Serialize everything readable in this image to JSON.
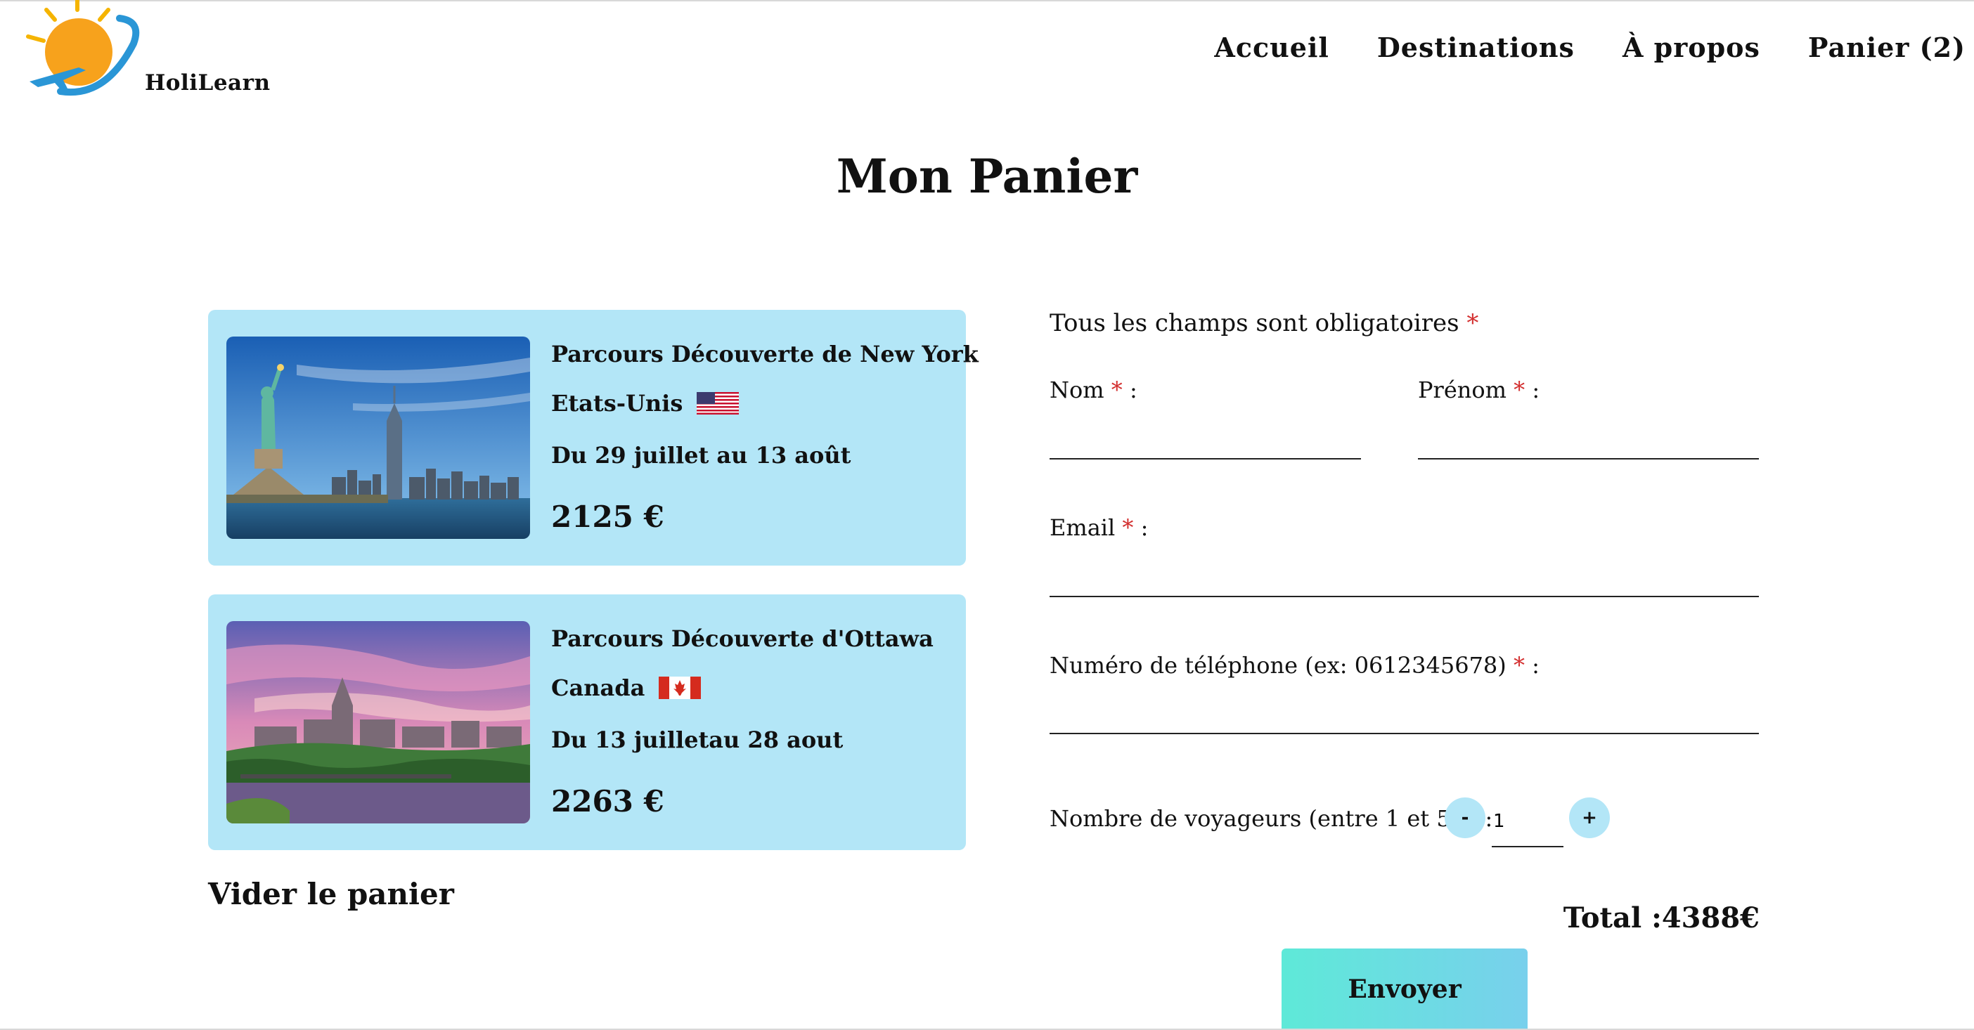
{
  "header": {
    "logo_text": "HoliLearn",
    "nav": [
      "Accueil",
      "Destinations",
      "À propos",
      "Panier (2)"
    ]
  },
  "page": {
    "title": "Mon Panier"
  },
  "cart": {
    "items": [
      {
        "title": "Parcours Découverte de New York",
        "country": "Etats-Unis",
        "flag": "us-flag-icon",
        "dates": "Du 29 juillet au 13 août",
        "price": "2125 €"
      },
      {
        "title": "Parcours Découverte d'Ottawa",
        "country": "Canada",
        "flag": "canada-flag-icon",
        "dates": "Du 13 juilletau 28 aout",
        "price": "2263 €"
      }
    ],
    "clear_label": "Vider le panier"
  },
  "form": {
    "note": "Tous les champs sont obligatoires",
    "required_mark": "*",
    "nom_label": "Nom",
    "prenom_label": "Prénom",
    "email_label": "Email",
    "tel_label": "Numéro de téléphone (ex: 0612345678)",
    "travelers_label": "Nombre de voyageurs (entre 1 et 5)",
    "colon": ":",
    "nom_value": "",
    "prenom_value": "",
    "email_value": "",
    "tel_value": "",
    "travelers_value": "1",
    "minus_label": "-",
    "plus_label": "+",
    "total": "Total :4388€",
    "submit_label": "Envoyer"
  },
  "colors": {
    "card_bg": "#b3e6f7",
    "required": "#d32f2f",
    "button_gradient_start": "#5ee9d8",
    "button_gradient_end": "#78d0ec"
  }
}
